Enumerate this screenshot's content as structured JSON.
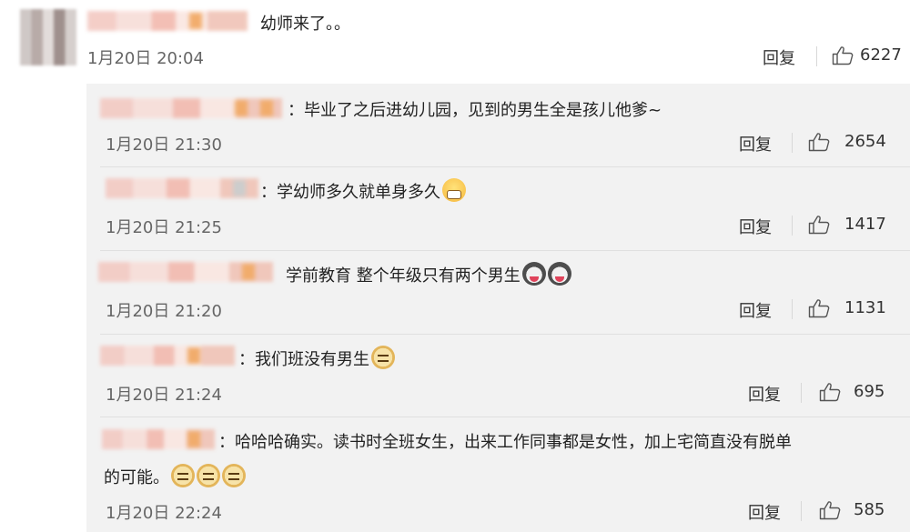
{
  "main_comment": {
    "text": "幼师来了。。",
    "time": "1月20日 20:04",
    "reply_label": "回复",
    "likes": "6227"
  },
  "replies": [
    {
      "text": "：毕业了之后进幼儿园，见到的男生全是孩儿他爹~",
      "time": "1月20日 21:30",
      "reply_label": "回复",
      "likes": "2654"
    },
    {
      "text": "：学幼师多久就单身多久",
      "time": "1月20日 21:25",
      "reply_label": "回复",
      "likes": "1417"
    },
    {
      "text": "学前教育 整个年级只有两个男生",
      "time": "1月20日 21:20",
      "reply_label": "回复",
      "likes": "1131"
    },
    {
      "text": "：我们班没有男生",
      "time": "1月20日 21:24",
      "reply_label": "回复",
      "likes": "695"
    },
    {
      "text_line1": "：哈哈哈确实。读书时全班女生，出来工作同事都是女性，加上宅简直没有脱单",
      "text_line2": "的可能。",
      "time": "1月20日 22:24",
      "reply_label": "回复",
      "likes": "585"
    }
  ],
  "icons": {
    "like": "thumbs-up-icon",
    "emoji_grin": "grin-emoji",
    "emoji_husky": "husky-emoji",
    "emoji_doge": "doge-emoji"
  }
}
